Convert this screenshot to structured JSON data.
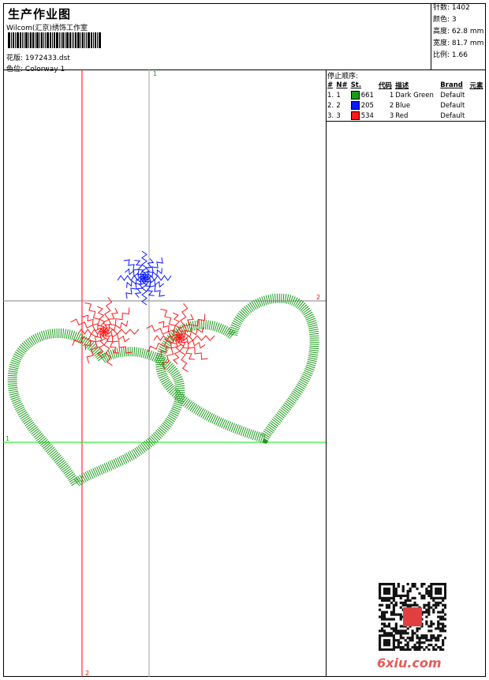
{
  "header": {
    "title": "生产作业图",
    "company": "Wilcom(汇京)绣饰工作室",
    "design_file_label": "花版:",
    "design_file": "1972433.dst",
    "colorway_label": "色位:",
    "colorway": "Colorway 1"
  },
  "info": [
    {
      "label": "针数:",
      "value": "1402"
    },
    {
      "label": "颜色:",
      "value": "3"
    },
    {
      "label": "高度:",
      "value": "62.8 mm"
    },
    {
      "label": "宽度:",
      "value": "81.7 mm"
    },
    {
      "label": "比例:",
      "value": "1.66"
    }
  ],
  "stop_sequence": {
    "title": "停止顺序:",
    "columns": [
      "#",
      "N#",
      "St.",
      "代码",
      "描述",
      "Brand",
      "元素"
    ],
    "rows": [
      {
        "num": "1.",
        "n": "1",
        "color": "#1a9a1a",
        "st": "661",
        "code": "1",
        "desc": "Dark Green",
        "brand": "Default",
        "element": ""
      },
      {
        "num": "2.",
        "n": "2",
        "color": "#0a1aff",
        "st": "205",
        "code": "2",
        "desc": "Blue",
        "brand": "Default",
        "element": ""
      },
      {
        "num": "3.",
        "n": "3",
        "color": "#ff1a1a",
        "st": "534",
        "code": "3",
        "desc": "Red",
        "brand": "Default",
        "element": ""
      }
    ]
  },
  "guides": {
    "top_label": "1",
    "right_label": "2",
    "left_label": "1",
    "bottom_label": "2"
  },
  "watermark": "6xiu.com"
}
